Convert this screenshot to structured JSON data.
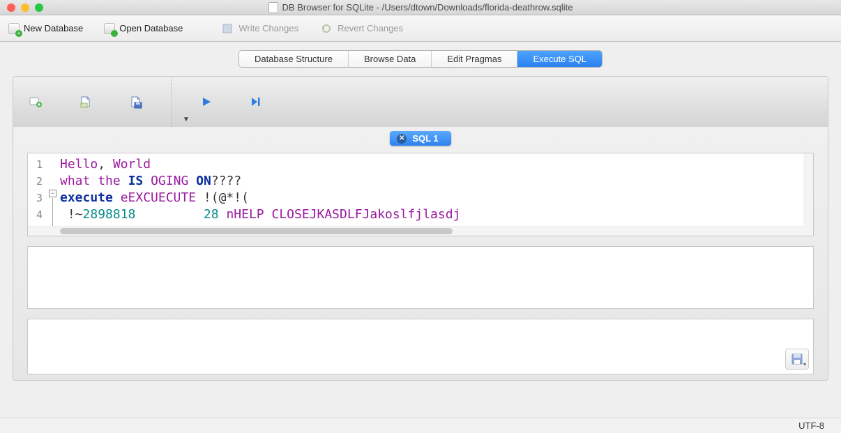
{
  "titlebar": {
    "title": "DB Browser for SQLite - /Users/dtown/Downloads/florida-deathrow.sqlite"
  },
  "toolbar": {
    "new_db": "New Database",
    "open_db": "Open Database",
    "write_changes": "Write Changes",
    "revert_changes": "Revert Changes"
  },
  "tabs": {
    "structure": "Database Structure",
    "browse": "Browse Data",
    "pragmas": "Edit Pragmas",
    "execute": "Execute SQL"
  },
  "script_tab": {
    "label": "SQL 1"
  },
  "editor": {
    "lines": [
      "1",
      "2",
      "3",
      "4"
    ],
    "l1_a": "Hello",
    "l1_b": ", ",
    "l1_c": "World",
    "l2_a": "what",
    "l2_b": " ",
    "l2_c": "the",
    "l2_d": " ",
    "l2_e": "IS",
    "l2_f": " ",
    "l2_g": "OGING",
    "l2_h": " ",
    "l2_i": "ON",
    "l2_j": "????",
    "l3_a": "execute",
    "l3_b": " ",
    "l3_c": "eEXCUECUTE",
    "l3_d": " !(@*!(",
    "l4_a": " !~",
    "l4_b": "2898818",
    "l4_c": "         ",
    "l4_d": "28",
    "l4_e": " ",
    "l4_f": "nHELP",
    "l4_g": " ",
    "l4_h": "CLOSEJKASDLFJakoslfjlasdj"
  },
  "status": {
    "encoding": "UTF-8"
  }
}
